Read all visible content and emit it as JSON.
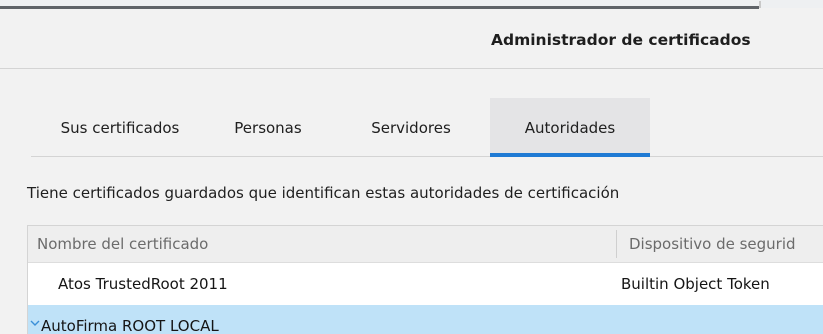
{
  "window": {
    "title": "Administrador de certificados"
  },
  "tabs": [
    {
      "label": "Sus certificados",
      "active": false
    },
    {
      "label": "Personas",
      "active": false
    },
    {
      "label": "Servidores",
      "active": false
    },
    {
      "label": "Autoridades",
      "active": true
    }
  ],
  "description": "Tiene certificados guardados que identifican estas autoridades de certificación",
  "table": {
    "columns": [
      "Nombre del certificado",
      "Dispositivo de segurid"
    ],
    "rows": [
      {
        "name": "Atos TrustedRoot 2011",
        "device": "Builtin Object Token",
        "selected": false
      },
      {
        "name": "AutoFirma ROOT LOCAL",
        "device": "",
        "selected": true,
        "expand_icon": "chevron-down-icon"
      }
    ]
  },
  "colors": {
    "accent": "#1f7ad4",
    "selected_row": "#bfe2f8",
    "active_tab_bg": "#e4e4e6"
  }
}
